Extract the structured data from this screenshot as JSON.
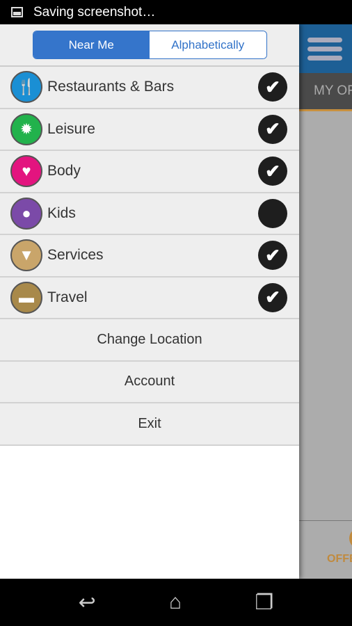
{
  "status_bar": {
    "text": "Saving screenshot…",
    "icon": "image-icon"
  },
  "sort_toggle": {
    "options": [
      "Near Me",
      "Alphabetically"
    ],
    "selected": "Near Me"
  },
  "categories": [
    {
      "label": "Restaurants & Bars",
      "icon": "cutlery-icon",
      "color": "#1a8fd4",
      "checked": true
    },
    {
      "label": "Leisure",
      "icon": "sun-icon",
      "color": "#22b24c",
      "checked": true
    },
    {
      "label": "Body",
      "icon": "heart-icon",
      "color": "#e3147f",
      "checked": true
    },
    {
      "label": "Kids",
      "icon": "balloon-icon",
      "color": "#7b4aa8",
      "checked": false
    },
    {
      "label": "Services",
      "icon": "tie-icon",
      "color": "#c9a56a",
      "checked": true
    },
    {
      "label": "Travel",
      "icon": "bed-icon",
      "color": "#a8894a",
      "checked": true
    }
  ],
  "actions": [
    "Change Location",
    "Account",
    "Exit"
  ],
  "background_app": {
    "tab_label": "MY OFFERS",
    "bottom_label": "OFFERS",
    "header_color": "#1d5f95",
    "accent": "#c08a3e"
  },
  "nav": {
    "back": "back-icon",
    "home": "home-icon",
    "recents": "recents-icon"
  }
}
